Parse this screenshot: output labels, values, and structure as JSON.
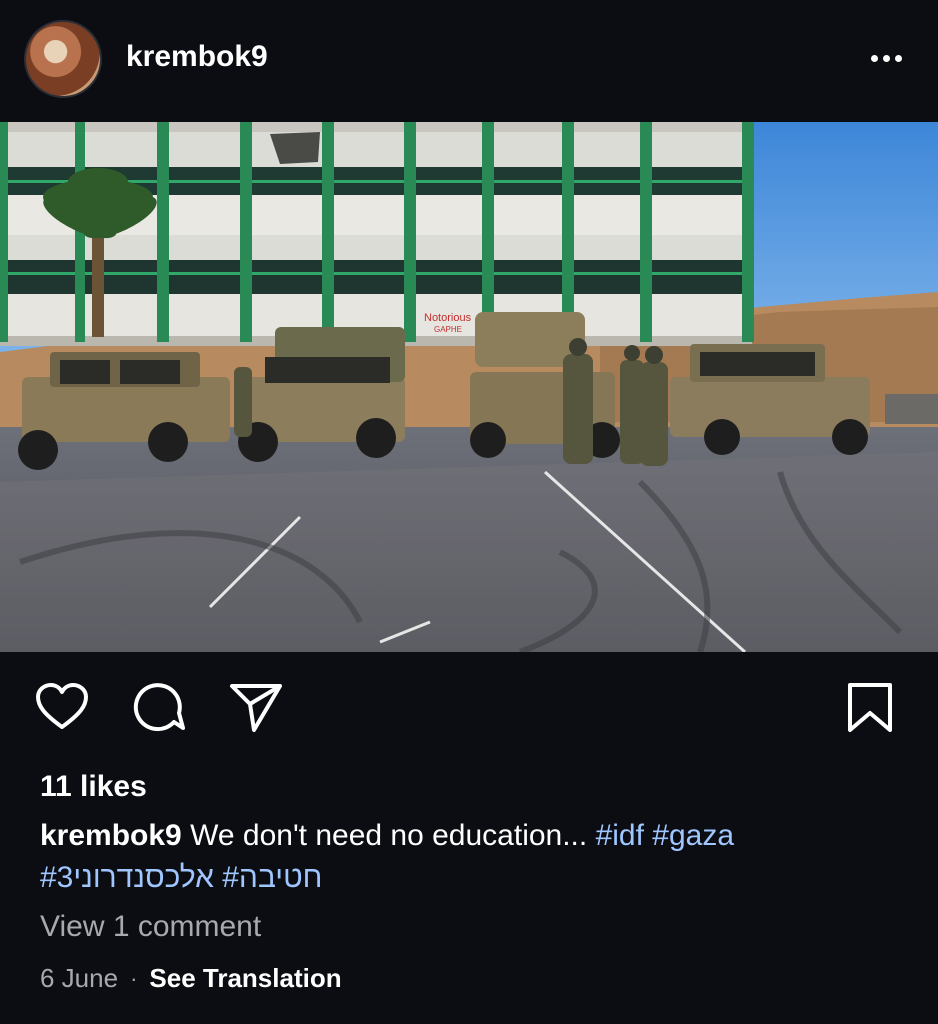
{
  "post": {
    "username": "krembok9",
    "likes": "11 likes",
    "caption_text": "We don't need no education...",
    "hashtags": [
      "#idf",
      "#gaza"
    ],
    "caption_line2": "#3חטיבה# אלכסנדרוני",
    "view_comments": "View 1 comment",
    "date": "6 June",
    "separator": "·",
    "see_translation": "See Translation"
  },
  "image": {
    "wall_graffiti_1": "Notorious",
    "wall_graffiti_2": "GAPHE"
  },
  "icons": {
    "more": "more-dots-icon",
    "like": "heart-icon",
    "comment": "comment-bubble-icon",
    "share": "paper-plane-icon",
    "save": "bookmark-icon"
  },
  "colors": {
    "background": "#0b0d12",
    "hashtag": "#9fc6ff",
    "secondary_text": "#a8a9ad"
  }
}
